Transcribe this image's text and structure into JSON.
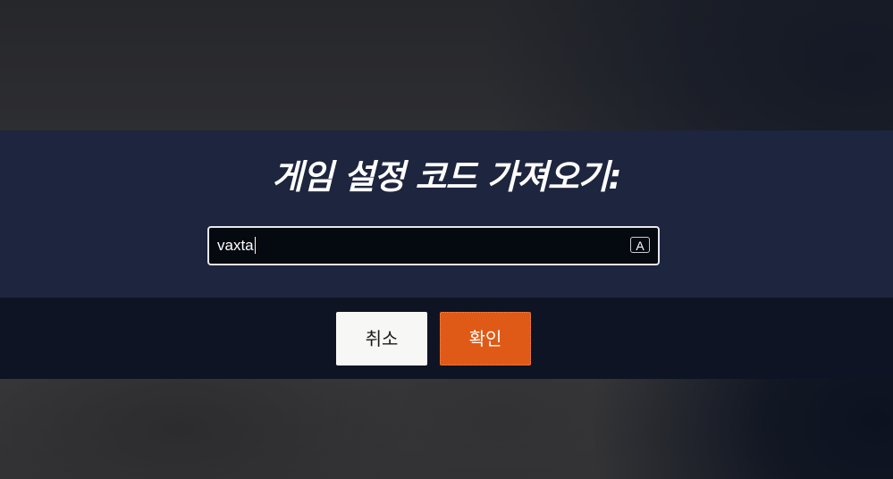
{
  "dialog": {
    "title": "게임 설정 코드 가져오기:",
    "input": {
      "value": "vaxta",
      "ime_indicator": "A"
    },
    "buttons": {
      "cancel_label": "취소",
      "confirm_label": "확인"
    }
  },
  "colors": {
    "title_band": "#1e253e",
    "button_band": "#0f1424",
    "input_bg": "#050910",
    "confirm_button": "#e05a17",
    "cancel_button": "#f7f7f5"
  }
}
